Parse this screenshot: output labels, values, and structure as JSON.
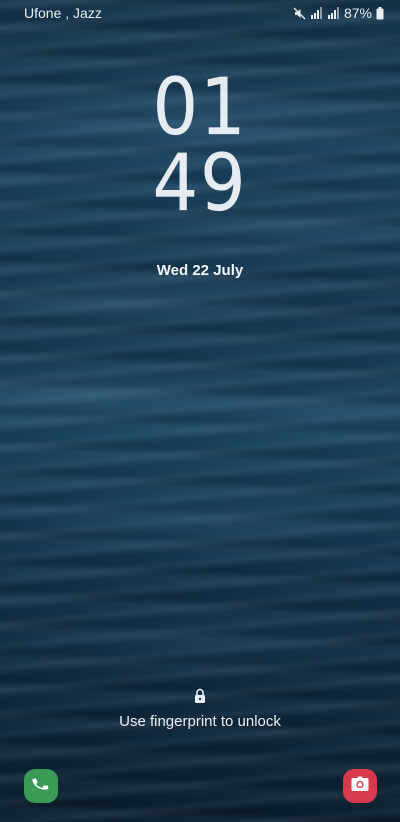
{
  "status_bar": {
    "carrier": "Ufone , Jazz",
    "battery_percent": "87%",
    "icons": [
      "mute-icon",
      "signal-icon",
      "signal-icon",
      "battery-icon"
    ]
  },
  "clock": {
    "hours": "01",
    "minutes": "49"
  },
  "date": "Wed 22 July",
  "unlock": {
    "hint": "Use fingerprint to unlock",
    "icon": "lock-icon"
  },
  "shortcuts": {
    "left": {
      "icon": "phone-icon",
      "color": "#3b9a55"
    },
    "right": {
      "icon": "camera-icon",
      "color": "#d83a4d"
    }
  },
  "colors": {
    "wallpaper_dominant": "#173b55",
    "text": "#ffffff"
  }
}
